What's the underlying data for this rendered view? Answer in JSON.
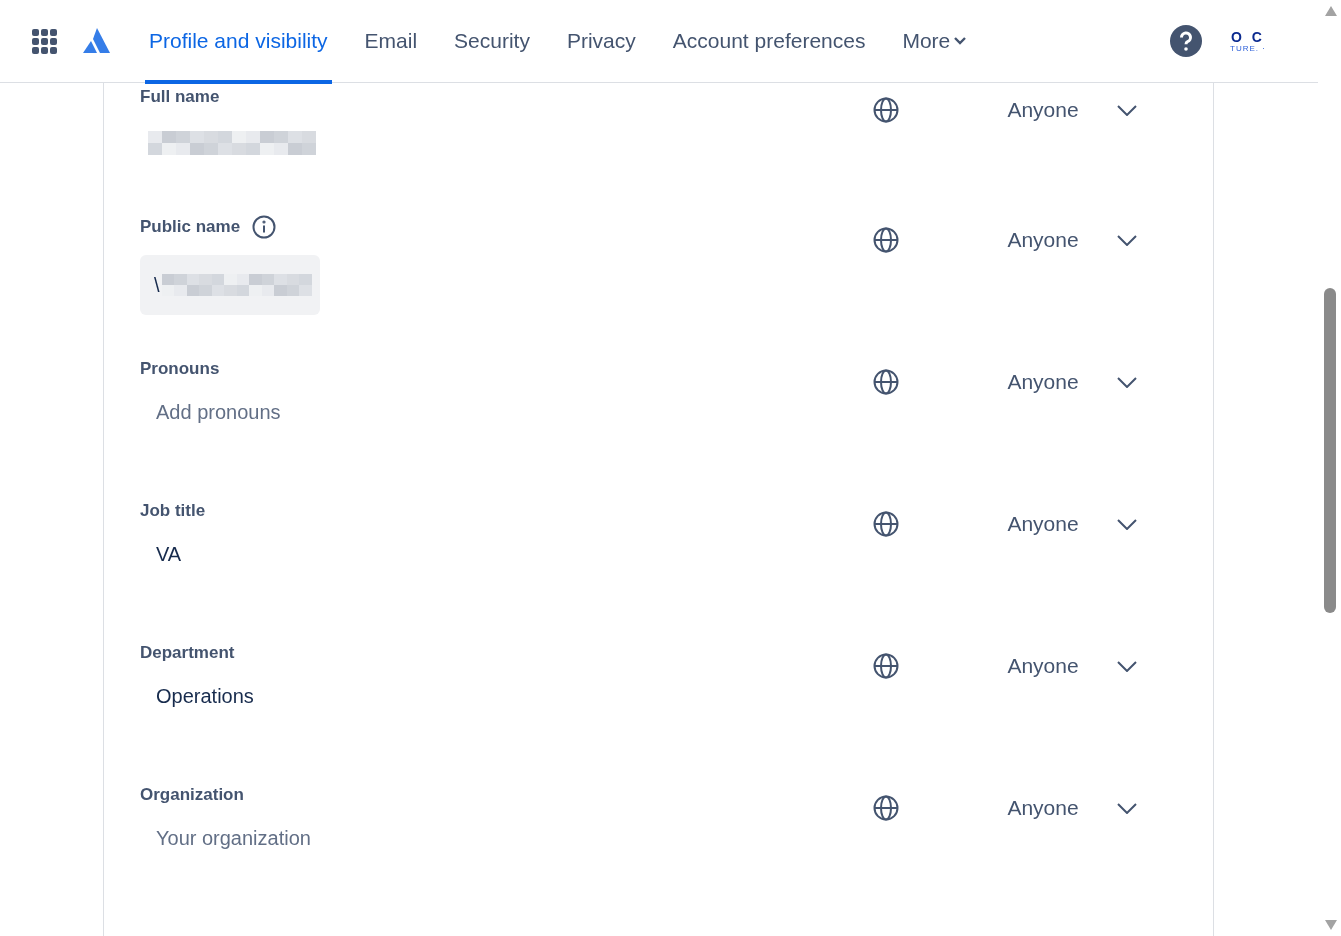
{
  "nav": {
    "tabs": [
      {
        "label": "Profile and visibility",
        "selected": true
      },
      {
        "label": "Email",
        "selected": false
      },
      {
        "label": "Security",
        "selected": false
      },
      {
        "label": "Privacy",
        "selected": false
      },
      {
        "label": "Account preferences",
        "selected": false
      }
    ],
    "more": "More",
    "avatar": {
      "initials": "O C",
      "tagline": "TURE. ·"
    }
  },
  "fields": [
    {
      "label": "Full name",
      "kind": "redacted-text",
      "visibility": "Anyone"
    },
    {
      "label": "Public name",
      "kind": "redacted-input",
      "value": "\\",
      "info": true,
      "visibility": "Anyone"
    },
    {
      "label": "Pronouns",
      "kind": "text",
      "placeholder": "Add pronouns",
      "visibility": "Anyone"
    },
    {
      "label": "Job title",
      "kind": "text",
      "value": "VA",
      "visibility": "Anyone"
    },
    {
      "label": "Department",
      "kind": "text",
      "value": "Operations",
      "visibility": "Anyone"
    },
    {
      "label": "Organization",
      "kind": "text",
      "placeholder": "Your organization",
      "visibility": "Anyone"
    }
  ]
}
